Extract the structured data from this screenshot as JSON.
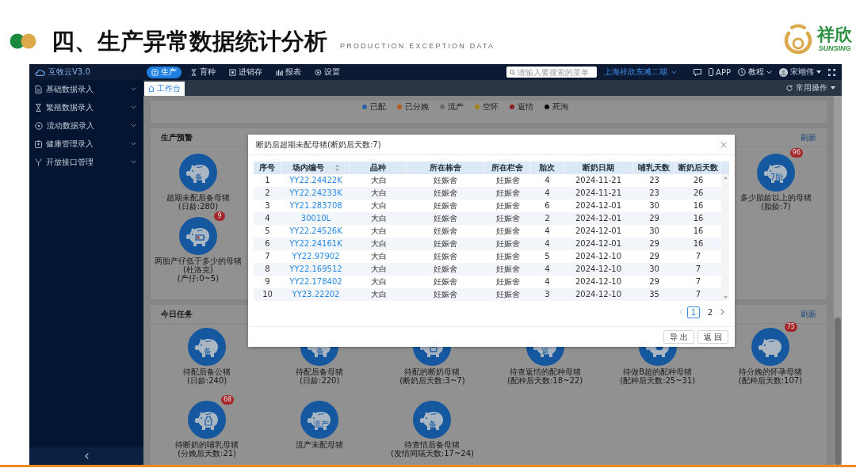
{
  "slide": {
    "title": "四、生产异常数据统计分析",
    "subtitle": "PRODUCTION EXCEPTION DATA",
    "logo": {
      "name": "祥欣",
      "latin": "SUNSING"
    }
  },
  "app": {
    "logo": "互牧云V3.0",
    "nav": [
      {
        "label": "生产",
        "kind": "production",
        "selected": true
      },
      {
        "label": "育种",
        "kind": "breeding",
        "selected": false
      },
      {
        "label": "进销存",
        "kind": "inventory",
        "selected": false
      },
      {
        "label": "报表",
        "kind": "report",
        "selected": false
      },
      {
        "label": "设置",
        "kind": "settings",
        "selected": false
      }
    ],
    "search": {
      "placeholder": "请输入要搜索的菜单"
    },
    "farm": "上海祥欣东滩二期",
    "app_link": "APP",
    "help": "教程",
    "user": "宋翊伟",
    "sidebar": [
      {
        "label": "基础数据录入",
        "kind": "base"
      },
      {
        "label": "繁殖数据录入",
        "kind": "breeding"
      },
      {
        "label": "流动数据录入",
        "kind": "flow"
      },
      {
        "label": "健康管理录入",
        "kind": "health"
      },
      {
        "label": "开放接口管理",
        "kind": "api"
      }
    ],
    "tabs": [
      {
        "label": "工作台",
        "selected": true
      }
    ],
    "quick_actions": "常用操作",
    "legend": [
      {
        "label": "已配",
        "color": "#2a62a3"
      },
      {
        "label": "已分娩",
        "color": "#b55a1e"
      },
      {
        "label": "流产",
        "color": "#6b6b6b"
      },
      {
        "label": "空怀",
        "color": "#a4861c"
      },
      {
        "label": "返情",
        "color": "#8c1f1f"
      },
      {
        "label": "死淘",
        "color": "#0a0a0a"
      }
    ],
    "warnings": {
      "title": "生产预警",
      "refresh": "刷新",
      "left_column": [
        {
          "label": "超期未配后备母猪",
          "condition": "(日龄:280)",
          "kind": "glyph",
          "glyph": "备"
        },
        {
          "label": "两胎产仔低于多少的母猪(杜洛克)",
          "condition": "(产仔:0~5)",
          "kind": "battery",
          "badge": "9"
        }
      ],
      "right_column": [
        {
          "label": "多少胎龄以上的母猪",
          "condition": "(胎龄:7)",
          "kind": "glyph",
          "glyph": "7胎",
          "badge": "96"
        }
      ]
    },
    "tasks": {
      "title": "今日任务",
      "refresh": "刷新",
      "items": [
        {
          "label": "待配后备公猪",
          "condition": "(日龄:240)",
          "kind": "glyph",
          "glyph": "备"
        },
        {
          "label": "待配后备母猪",
          "condition": "(日龄:220)",
          "kind": "glyph",
          "glyph": "备"
        },
        {
          "label": "待配的断奶母猪",
          "condition": "(断奶后天数:3~7)",
          "kind": "card"
        },
        {
          "label": "待查返情的配种母猪",
          "condition": "(配种后天数:18~22)",
          "kind": "glyph",
          "glyph": "返"
        },
        {
          "label": "待做B超的配种母猪",
          "condition": "(配种后天数:25~31)",
          "kind": "spot"
        },
        {
          "label": "待分娩的怀孕母猪",
          "condition": "(配种后天数:107)",
          "kind": "plain",
          "badge": "75"
        },
        {
          "label": "待断奶的哺乳母猪",
          "condition": "(分娩后天数:21)",
          "kind": "bottle",
          "badge": "68"
        },
        {
          "label": "流产未配母猪",
          "kind": "glyph",
          "glyph": "流产"
        },
        {
          "label": "待查情后备母猪",
          "condition": "(发情间隔天数:17~24)",
          "kind": "glyph",
          "glyph": "备"
        }
      ]
    }
  },
  "dialog": {
    "title": "断奶后超期未配母猪(断奶后天数:7)",
    "columns": [
      {
        "label": "序号",
        "sortable": false,
        "link": false
      },
      {
        "label": "场内编号",
        "sortable": true,
        "link": true
      },
      {
        "label": "品种",
        "sortable": false,
        "link": false
      },
      {
        "label": "所在栋舍",
        "sortable": false,
        "link": false
      },
      {
        "label": "所在栏舍",
        "sortable": false,
        "link": false
      },
      {
        "label": "胎次",
        "sortable": false,
        "link": false
      },
      {
        "label": "断奶日期",
        "sortable": false,
        "link": false
      },
      {
        "label": "哺乳天数",
        "sortable": false,
        "link": false
      },
      {
        "label": "断奶后天数",
        "sortable": false,
        "link": false
      }
    ],
    "rows": [
      [
        "1",
        "YY22.24422K",
        "大白",
        "妊娠舍",
        "妊娠舍",
        "4",
        "2024-11-21",
        "23",
        "26"
      ],
      [
        "2",
        "YY22.24233K",
        "大白",
        "妊娠舍",
        "妊娠舍",
        "4",
        "2024-11-21",
        "23",
        "26"
      ],
      [
        "3",
        "YY21.283708",
        "大白",
        "妊娠舍",
        "妊娠舍",
        "6",
        "2024-12-01",
        "30",
        "16"
      ],
      [
        "4",
        "30010L",
        "大白",
        "妊娠舍",
        "妊娠舍",
        "2",
        "2024-12-01",
        "29",
        "16"
      ],
      [
        "5",
        "YY22.24526K",
        "大白",
        "妊娠舍",
        "妊娠舍",
        "4",
        "2024-12-01",
        "30",
        "16"
      ],
      [
        "6",
        "YY22.24161K",
        "大白",
        "妊娠舍",
        "妊娠舍",
        "4",
        "2024-12-01",
        "29",
        "16"
      ],
      [
        "7",
        "YY22.97902",
        "大白",
        "妊娠舍",
        "妊娠舍",
        "5",
        "2024-12-10",
        "29",
        "7"
      ],
      [
        "8",
        "YY22.169512",
        "大白",
        "妊娠舍",
        "妊娠舍",
        "4",
        "2024-12-10",
        "30",
        "7"
      ],
      [
        "9",
        "YY22.178402",
        "大白",
        "妊娠舍",
        "妊娠舍",
        "4",
        "2024-12-10",
        "29",
        "7"
      ],
      [
        "10",
        "YY23.22202",
        "大白",
        "妊娠舍",
        "妊娠舍",
        "3",
        "2024-12-10",
        "35",
        "7"
      ]
    ],
    "pagination": {
      "pages": [
        {
          "label": "1",
          "selected": true
        },
        {
          "label": "2",
          "selected": false
        }
      ]
    },
    "buttons": [
      "导出",
      "返回"
    ]
  }
}
